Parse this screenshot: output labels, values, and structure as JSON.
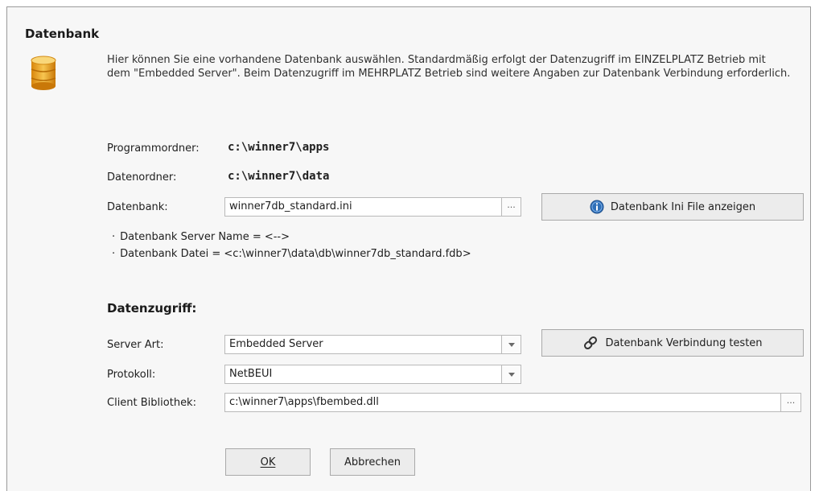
{
  "dialog": {
    "title": "Datenbank",
    "description": "Hier können Sie eine vorhandene Datenbank auswählen. Standardmäßig erfolgt der Datenzugriff im EINZELPLATZ Betrieb mit dem \"Embedded Server\". Beim Datenzugriff im MEHRPLATZ Betrieb sind weitere Angaben zur Datenbank Verbindung erforderlich."
  },
  "paths": {
    "programmordner_label": "Programmordner:",
    "programmordner_value": "c:\\winner7\\apps",
    "datenordner_label": "Datenordner:",
    "datenordner_value": "c:\\winner7\\data",
    "datenbank_label": "Datenbank:",
    "datenbank_value": "winner7db_standard.ini",
    "browse_label": "···",
    "ini_button_label": "Datenbank Ini File anzeigen"
  },
  "info": {
    "server_name": "Datenbank Server Name = <-->",
    "datei": "Datenbank Datei = <c:\\winner7\\data\\db\\winner7db_standard.fdb>"
  },
  "access": {
    "section_title": "Datenzugriff:",
    "server_art_label": "Server Art:",
    "server_art_value": "Embedded Server",
    "test_button_label": "Datenbank Verbindung testen",
    "protokoll_label": "Protokoll:",
    "protokoll_value": "NetBEUI",
    "client_label": "Client Bibliothek:",
    "client_value": "c:\\winner7\\apps\\fbembed.dll",
    "client_browse_label": "···"
  },
  "footer": {
    "ok_label": "OK",
    "cancel_label": "Abbrechen"
  },
  "icons": {
    "database": "database-icon",
    "info": "info-icon",
    "link": "link-icon"
  },
  "colors": {
    "db_gold": "#e8a21c",
    "info_blue": "#2f6fb8"
  }
}
